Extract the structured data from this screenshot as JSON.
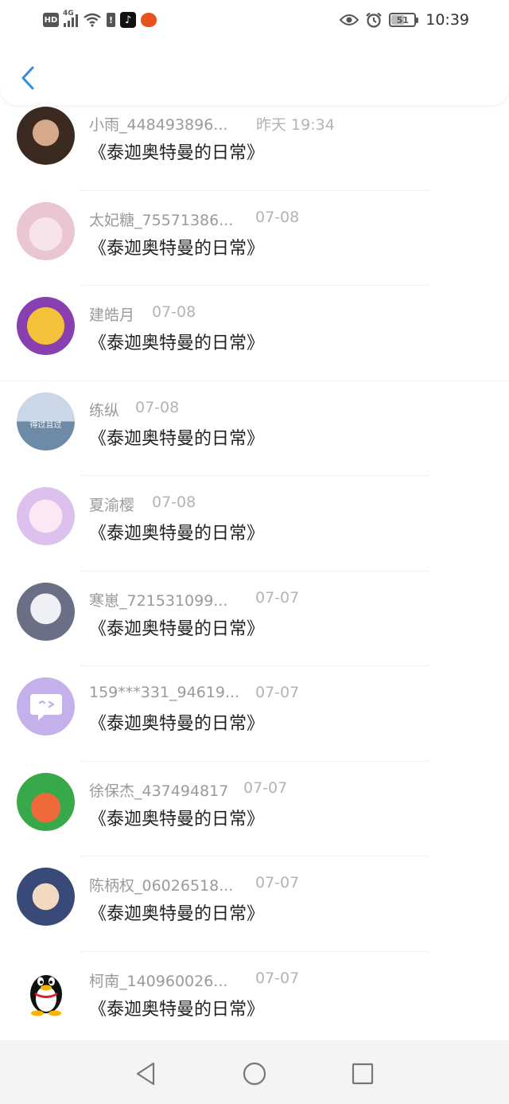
{
  "status_bar": {
    "hd": "HD",
    "network": "4G",
    "battery_level": "51",
    "time": "10:39"
  },
  "colors": {
    "accent": "#2f8fe0",
    "name_text": "#9a9a9a",
    "date_text": "#b4b4b4",
    "title_text": "#222222"
  },
  "messages": [
    {
      "name": "小雨_448493896...",
      "date": "昨天 19:34",
      "title": "《泰迦奥特曼的日常》",
      "avatar": "person-photo-avatar"
    },
    {
      "name": "太妃糖_75571386...",
      "date": "07-08",
      "title": "《泰迦奥特曼的日常》",
      "avatar": "anime-girl-avatar"
    },
    {
      "name": "建皓月",
      "date": "07-08",
      "title": "《泰迦奥特曼的日常》",
      "avatar": "cartoon-avatar"
    },
    {
      "name": "练纵",
      "date": "07-08",
      "title": "《泰迦奥特曼的日常》",
      "avatar": "seaside-avatar",
      "avatar_text": "得过且过"
    },
    {
      "name": "夏渝樱",
      "date": "07-08",
      "title": "《泰迦奥特曼的日常》",
      "avatar": "anime-girl-avatar"
    },
    {
      "name": "寒崽_721531099...",
      "date": "07-07",
      "title": "《泰迦奥特曼的日常》",
      "avatar": "anime-boy-avatar"
    },
    {
      "name": "159***331_94619...",
      "date": "07-07",
      "title": "《泰迦奥特曼的日常》",
      "avatar": "default-chat-avatar"
    },
    {
      "name": "徐保杰_437494817",
      "date": "07-07",
      "title": "《泰迦奥特曼的日常》",
      "avatar": "game-avatar"
    },
    {
      "name": "陈柄权_06026518...",
      "date": "07-07",
      "title": "《泰迦奥特曼的日常》",
      "avatar": "conan-avatar"
    },
    {
      "name": "柯南_140960026...",
      "date": "07-07",
      "title": "《泰迦奥特曼的日常》",
      "avatar": "qq-penguin-avatar"
    }
  ]
}
